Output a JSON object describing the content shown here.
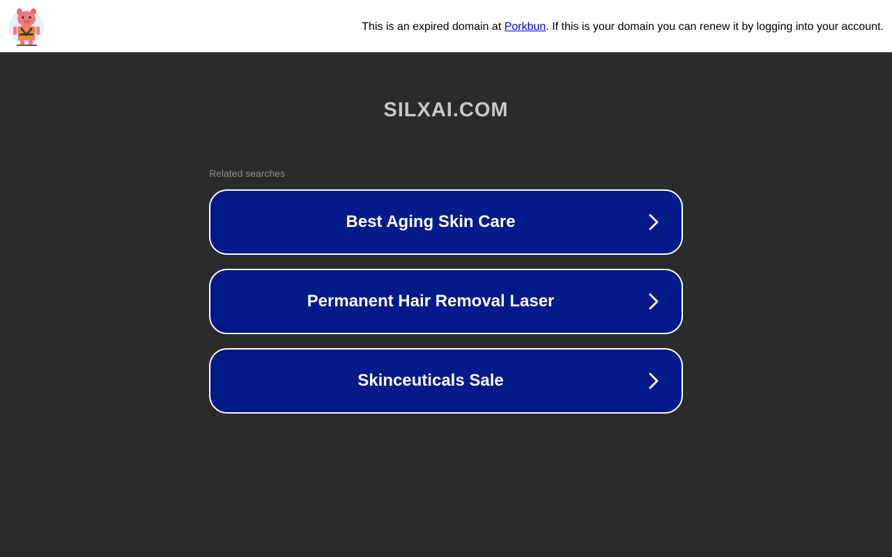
{
  "header": {
    "logo_icon": "pig-mascot-logo-icon",
    "notice_prefix": "This is an expired domain at ",
    "notice_link": "Porkbun",
    "notice_suffix": ". If this is your domain you can renew it by logging into your account."
  },
  "main": {
    "domain": "SILXAI.COM",
    "related_label": "Related searches",
    "searches": [
      {
        "label": "Best Aging Skin Care",
        "icon": "chevron-right-icon"
      },
      {
        "label": "Permanent Hair Removal Laser",
        "icon": "chevron-right-icon"
      },
      {
        "label": "Skinceuticals Sale",
        "icon": "chevron-right-icon"
      }
    ]
  },
  "colors": {
    "page_background": "#2b2b2b",
    "button_background": "#021a8a",
    "title_text": "#c9c9c9",
    "link": "#0000ee"
  }
}
